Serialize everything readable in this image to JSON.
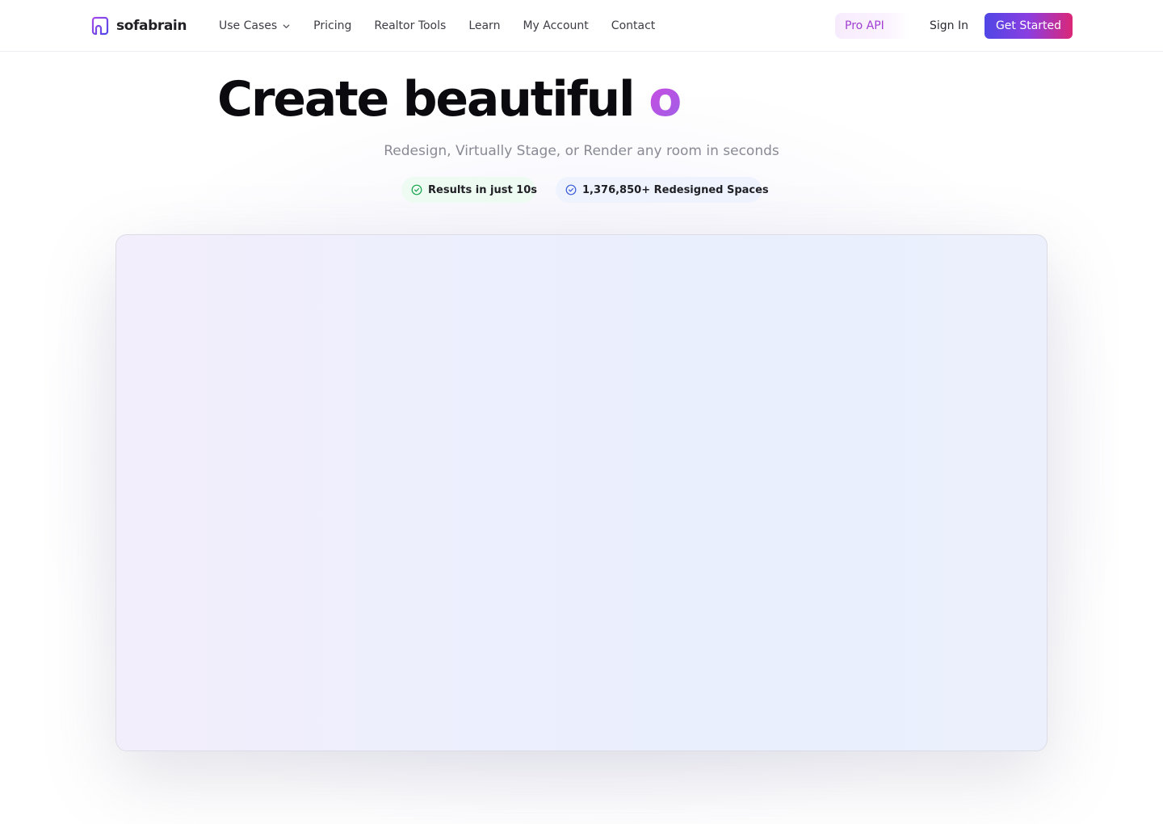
{
  "brand": {
    "name": "sofabrain",
    "logo_icon": "house-outline-icon"
  },
  "nav": {
    "items": [
      {
        "label": "Use Cases",
        "has_dropdown": true,
        "dropdown_icon": "chevron-down-icon"
      },
      {
        "label": "Pricing"
      },
      {
        "label": "Realtor Tools"
      },
      {
        "label": "Learn"
      },
      {
        "label": "My Account"
      },
      {
        "label": "Contact"
      }
    ],
    "pro_api_label": "Pro API",
    "sign_in_label": "Sign In",
    "get_started_label": "Get Started"
  },
  "hero": {
    "title_static": "Create beautiful",
    "title_typed": "o",
    "subtitle": "Redesign, Virtually Stage, or Render any room in seconds",
    "badges": [
      {
        "label": "Results in just 10s",
        "icon": "check-circle-icon",
        "color": "#16a34a"
      },
      {
        "label": "1,376,850+ Redesigned Spaces",
        "icon": "check-circle-icon",
        "color": "#3b5bdb"
      }
    ]
  },
  "colors": {
    "accent_start": "#4f46e5",
    "accent_end": "#db2777",
    "pro_api_text": "#a23fd2",
    "typed_gradient_start": "#d146e0",
    "typed_gradient_end": "#9b63e8"
  }
}
